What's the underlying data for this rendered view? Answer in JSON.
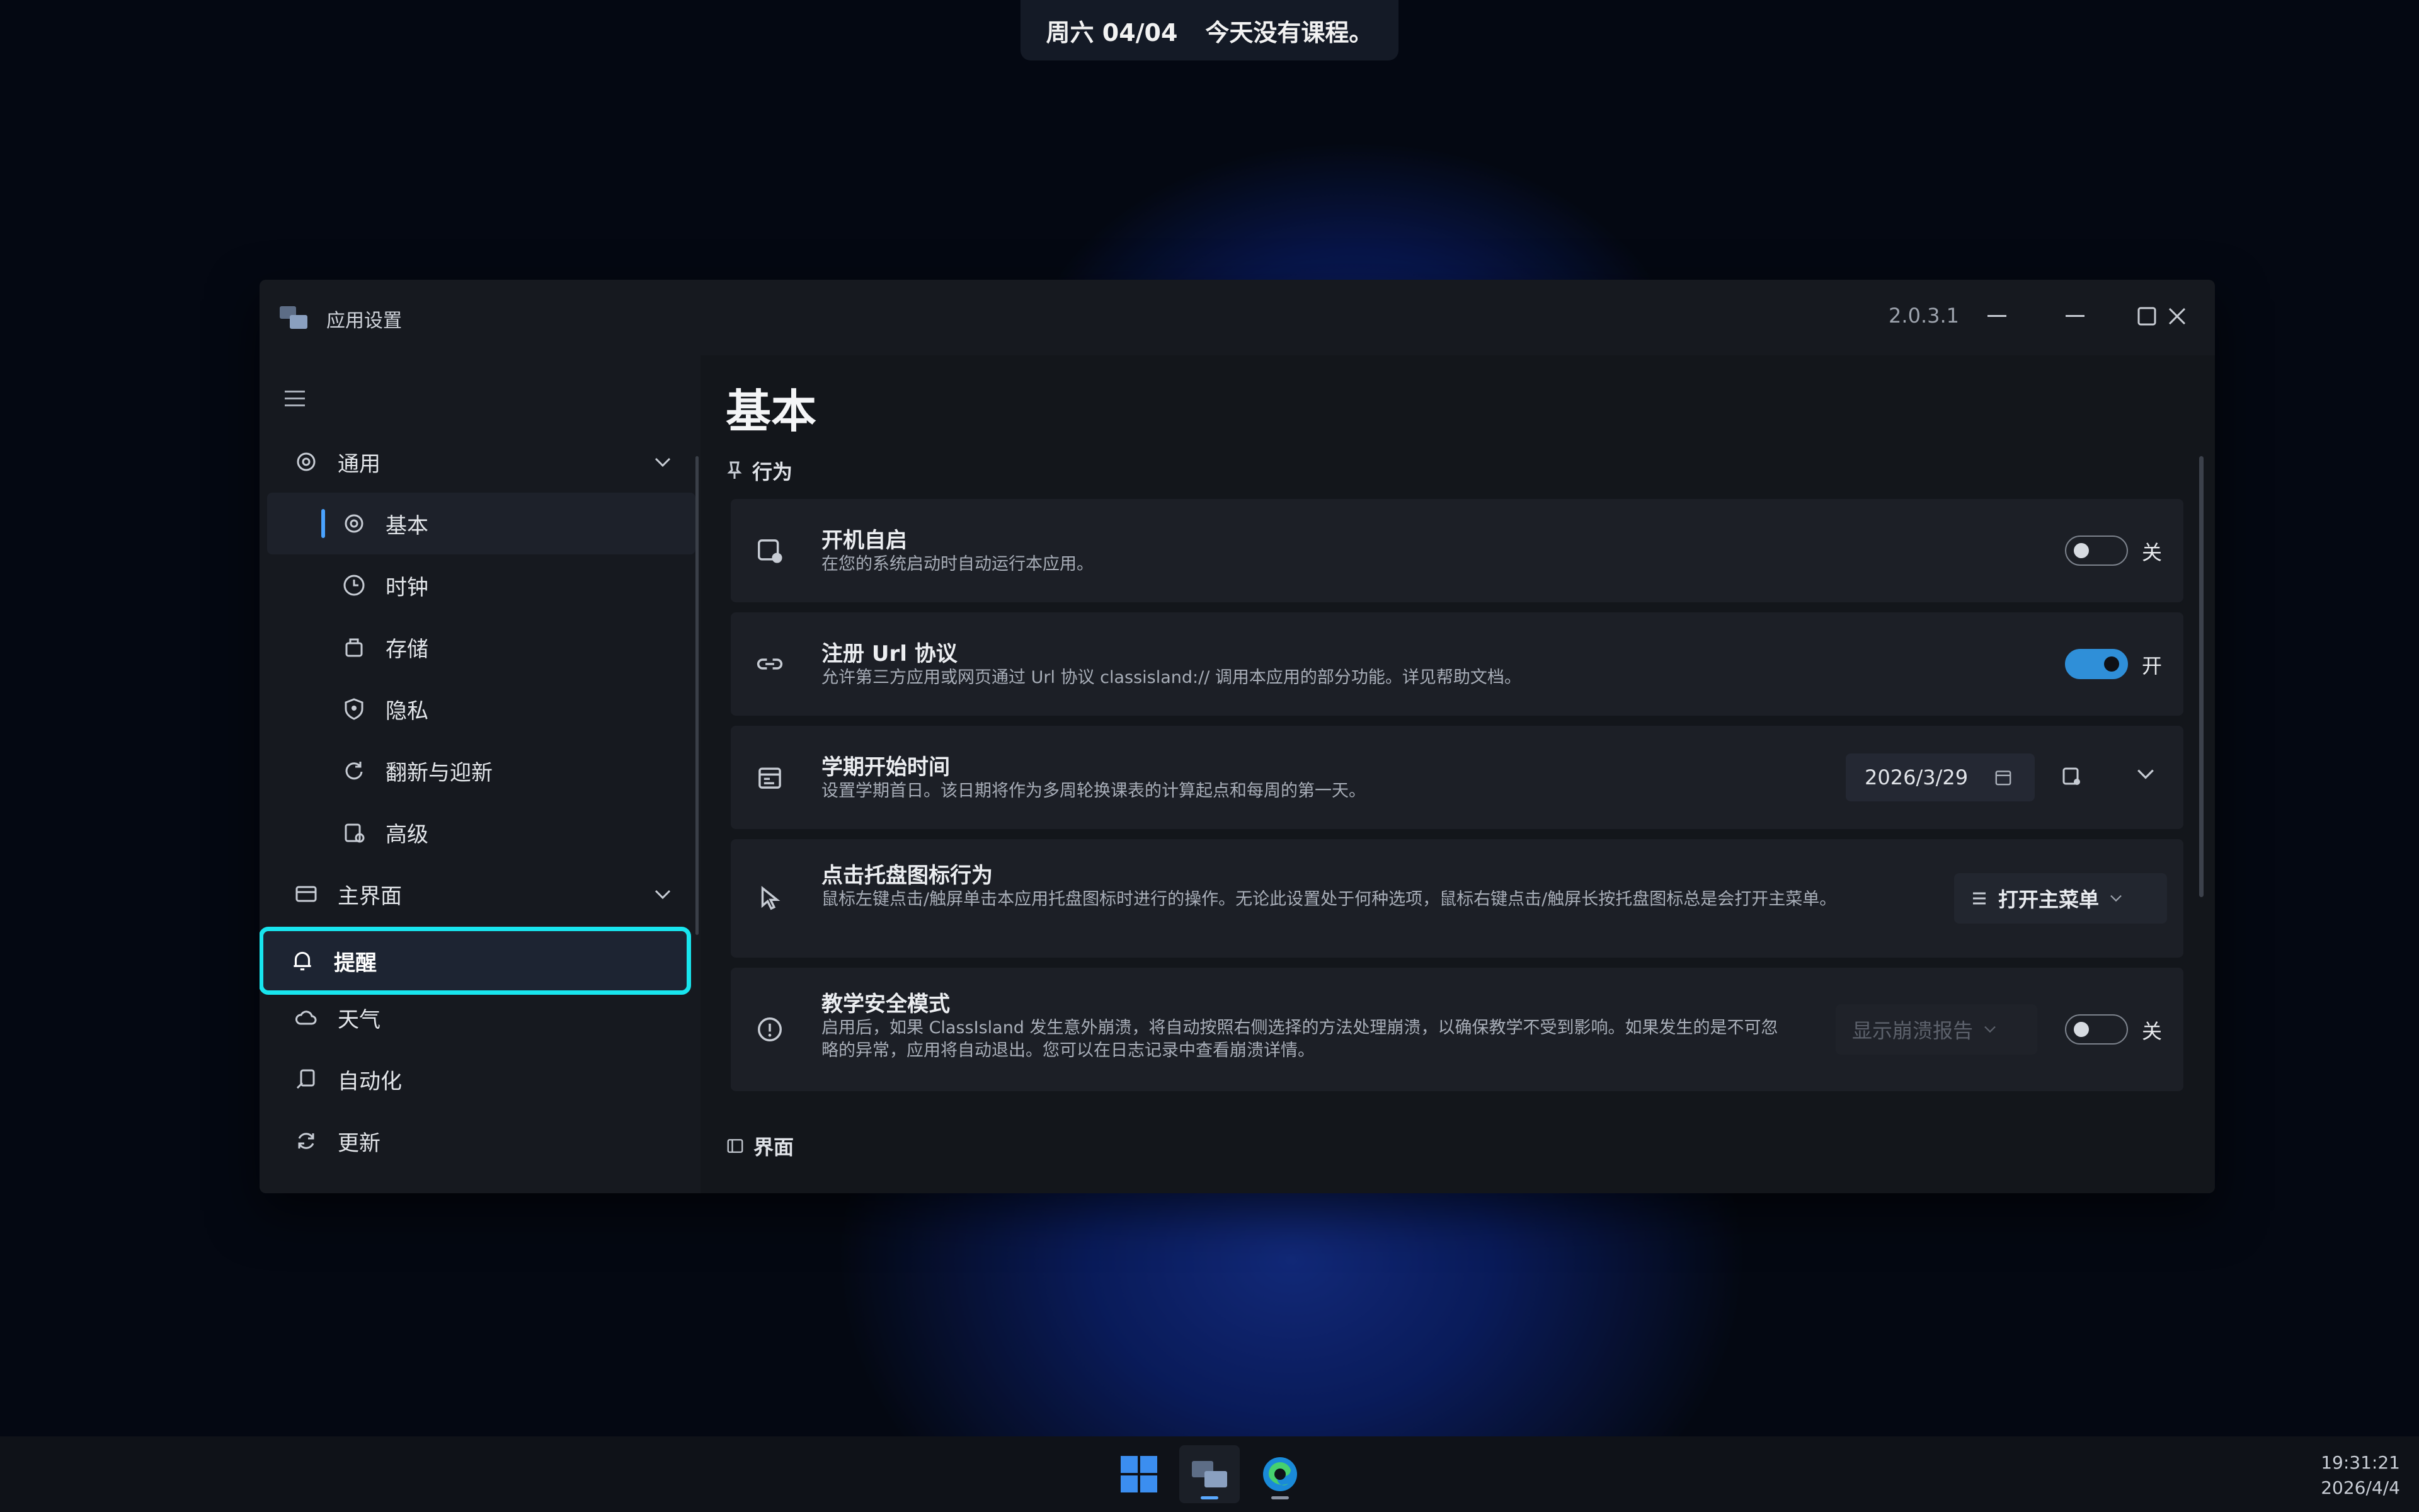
{
  "banner": {
    "date": "周六 04/04",
    "message": "今天没有课程。"
  },
  "window": {
    "title": "应用设置",
    "version": "2.0.3.1"
  },
  "sidebar": {
    "items": [
      {
        "label": "通用",
        "icon": "gear-icon"
      },
      {
        "label": "基本",
        "icon": "gear-icon"
      },
      {
        "label": "时钟",
        "icon": "clock-icon"
      },
      {
        "label": "存储",
        "icon": "storage-icon"
      },
      {
        "label": "隐私",
        "icon": "privacy-icon"
      },
      {
        "label": "翻新与迎新",
        "icon": "refresh-icon"
      },
      {
        "label": "高级",
        "icon": "advanced-icon"
      },
      {
        "label": "主界面",
        "icon": "window-icon"
      },
      {
        "label": "提醒",
        "icon": "bell-icon"
      },
      {
        "label": "天气",
        "icon": "weather-icon"
      },
      {
        "label": "自动化",
        "icon": "automation-icon"
      },
      {
        "label": "更新",
        "icon": "update-icon"
      }
    ]
  },
  "main": {
    "title": "基本",
    "section_behavior": "行为",
    "section_ui": "界面",
    "cards": {
      "autostart": {
        "title": "开机自启",
        "desc": "在您的系统启动时自动运行本应用。",
        "state": "关"
      },
      "url": {
        "title": "注册 Url 协议",
        "desc": "允许第三方应用或网页通过 Url 协议 classisland:// 调用本应用的部分功能。详见帮助文档。",
        "state": "开"
      },
      "semester": {
        "title": "学期开始时间",
        "desc": "设置学期首日。该日期将作为多周轮换课表的计算起点和每周的第一天。",
        "date": "2026/3/29"
      },
      "tray": {
        "title": "点击托盘图标行为",
        "desc": "鼠标左键点击/触屏单击本应用托盘图标时进行的操作。无论此设置处于何种选项，鼠标右键点击/触屏长按托盘图标总是会打开主菜单。",
        "option": "打开主菜单"
      },
      "safe": {
        "title": "教学安全模式",
        "desc": "启用后，如果 ClassIsland 发生意外崩溃，将自动按照右侧选择的方法处理崩溃，以确保教学不受到影响。如果发生的是不可忽略的异常，应用将自动退出。您可以在日志记录中查看崩溃详情。",
        "option": "显示崩溃报告",
        "state": "关"
      }
    }
  },
  "taskbar": {
    "time": "19:31:21",
    "date": "2026/4/4"
  },
  "colors": {
    "accent": "#2f8fd8",
    "selection_outline": "#18e5ee"
  }
}
